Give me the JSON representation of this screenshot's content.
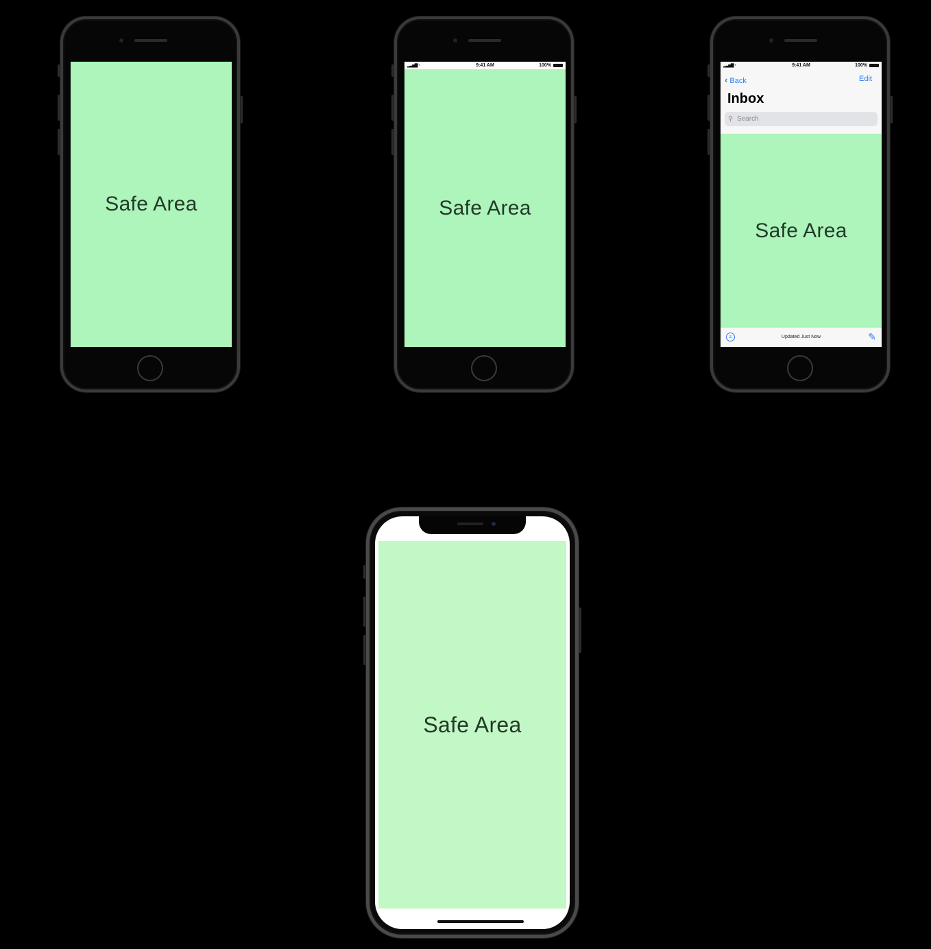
{
  "phones": [
    {
      "variant": "no-bars",
      "safe_label": "Safe Area"
    },
    {
      "variant": "status-bar",
      "safe_label": "Safe Area",
      "status_bar": {
        "time": "9:41 AM",
        "battery": "100%"
      }
    },
    {
      "variant": "mail-inbox",
      "safe_label": "Safe Area",
      "status_bar": {
        "time": "9:41 AM",
        "battery": "100%"
      },
      "nav": {
        "back_label": "Back",
        "edit_label": "Edit",
        "title": "Inbox",
        "search_placeholder": "Search"
      },
      "toolbar": {
        "status_text": "Updated Just Now"
      }
    },
    {
      "variant": "iphone-x",
      "safe_label": "Safe Area"
    }
  ],
  "colors": {
    "safe_area": "#adf5bb",
    "safe_area_x": "#c2f8c6",
    "accent": "#2b7bf0",
    "background": "#000000"
  },
  "icons": [
    "back-chevron-icon",
    "search-icon",
    "filter-icon",
    "compose-icon",
    "signal-icon",
    "wifi-icon",
    "battery-icon"
  ]
}
